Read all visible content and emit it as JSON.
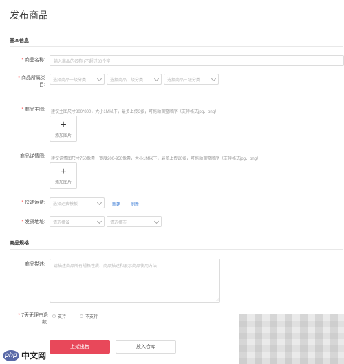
{
  "page_title": "发布商品",
  "basic_section": {
    "title": "基本信息"
  },
  "name_field": {
    "label": "商品名称:",
    "placeholder": "输入商品的名称 (不超过30个字"
  },
  "category_field": {
    "label_line1": "商品所属类",
    "label_line2": "目:",
    "selects": [
      "选择商品一级分类",
      "选择商品二级分类",
      "选择商品三级分类"
    ]
  },
  "main_image_field": {
    "label": "商品主图:",
    "hint": "建议主图尺寸800*800，大小1M以下，最多上传3张，可拖动调整顺序（支持格式jpg、png）",
    "upload_label": "添加图片"
  },
  "detail_image_field": {
    "label": "商品详情图:",
    "hint": "建议详情图尺寸750像素，宽度200-950像素，大小1M以下，最多上传20张，可拖动调整顺序（支持格式jpg、png）",
    "upload_label": "添加图片"
  },
  "shipping_template_field": {
    "label": "快递运费:",
    "select": "选择运费模板",
    "link_new": "新建",
    "link_refresh": "刷新"
  },
  "ship_from_field": {
    "label": "发货地址:",
    "selects": [
      "请选择省",
      "请选择市"
    ]
  },
  "spec_section": {
    "title": "商品规格"
  },
  "description_field": {
    "label": "商品描述:",
    "placeholder": "请描述商品所有规格性质、商品描述和展示商品使用方法"
  },
  "return_policy_field": {
    "label_line1": "7天无理由退",
    "label_line2": "款:",
    "options": [
      "支持",
      "不支持"
    ]
  },
  "actions": {
    "publish": "上架出售",
    "save_draft": "放入仓库"
  },
  "watermark": {
    "badge": "php",
    "text": "中文网"
  }
}
